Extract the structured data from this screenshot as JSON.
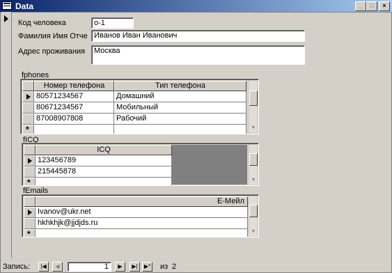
{
  "window": {
    "title": "Data",
    "minimize": "_",
    "maximize": "□",
    "close": "×"
  },
  "form": {
    "code_label": "Код человека",
    "code_value": "o-1",
    "name_label": "Фамилия Имя Отче",
    "name_value": "Иванов Иван Иванович",
    "address_label": "Адрес проживания",
    "address_value": "Москва"
  },
  "phones": {
    "label": "fphones",
    "columns": [
      "Номер телефона",
      "Тип телефона"
    ],
    "rows": [
      [
        "80571234567",
        "Домашний"
      ],
      [
        "80671234567",
        "Мобильный"
      ],
      [
        "87008907808",
        "Рабочий"
      ]
    ]
  },
  "icq": {
    "label": "fICQ",
    "columns": [
      "ICQ"
    ],
    "rows": [
      "123456789",
      "215445878"
    ]
  },
  "emails": {
    "label": "fEmails",
    "columns": [
      "E-Мейл"
    ],
    "rows": [
      "Ivanov@ukr.net",
      "hkhkhjk@jjdjds.ru"
    ]
  },
  "navigation": {
    "label": "Запись:",
    "current": "1",
    "of": "из",
    "total": "2",
    "first": "|◀",
    "prev": "◀",
    "next": "▶",
    "last": "▶|",
    "new": "▶*"
  }
}
